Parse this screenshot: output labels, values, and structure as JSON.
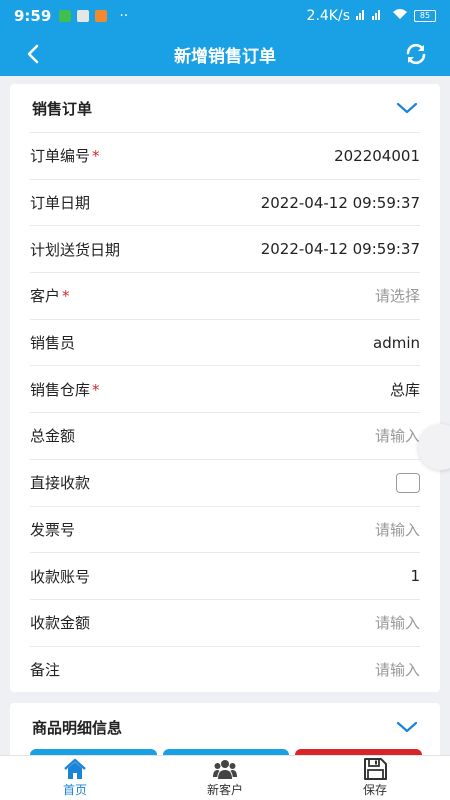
{
  "status_bar": {
    "time": "9:59",
    "network_speed": "2.4K/s",
    "battery": "85"
  },
  "header": {
    "title": "新增销售订单"
  },
  "sales_order": {
    "section_title": "销售订单",
    "rows": [
      {
        "label": "订单编号",
        "required": "*",
        "value": "202204001",
        "placeholder": ""
      },
      {
        "label": "订单日期",
        "required": "",
        "value": "2022-04-12 09:59:37",
        "placeholder": ""
      },
      {
        "label": "计划送货日期",
        "required": "",
        "value": "2022-04-12 09:59:37",
        "placeholder": ""
      },
      {
        "label": "客户",
        "required": "*",
        "value": "",
        "placeholder": "请选择"
      },
      {
        "label": "销售员",
        "required": "",
        "value": "admin",
        "placeholder": ""
      },
      {
        "label": "销售仓库",
        "required": "*",
        "value": "总库",
        "placeholder": ""
      },
      {
        "label": "总金额",
        "required": "",
        "value": "",
        "placeholder": "请输入"
      },
      {
        "label": "直接收款",
        "required": "",
        "value": "",
        "placeholder": ""
      },
      {
        "label": "发票号",
        "required": "",
        "value": "",
        "placeholder": "请输入"
      },
      {
        "label": "收款账号",
        "required": "",
        "value": "1",
        "placeholder": ""
      },
      {
        "label": "收款金额",
        "required": "",
        "value": "",
        "placeholder": "请输入"
      },
      {
        "label": "备注",
        "required": "",
        "value": "",
        "placeholder": "请输入"
      }
    ]
  },
  "product_details": {
    "section_title": "商品明细信息"
  },
  "bottom_nav": {
    "home": "首页",
    "new_customer": "新客户",
    "save": "保存"
  },
  "colors": {
    "primary": "#1aa0e5",
    "required": "#d12a2a",
    "active_nav": "#1a84d8",
    "danger_btn": "#d9252a"
  }
}
